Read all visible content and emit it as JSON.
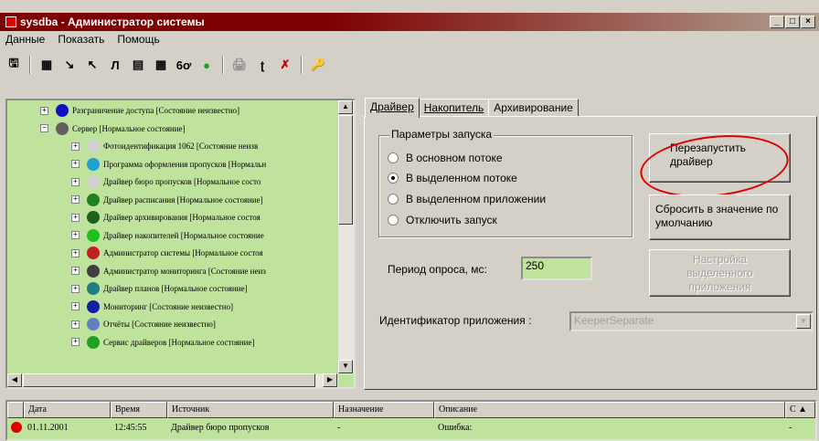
{
  "window": {
    "title": "sysdba - Администратор системы",
    "min_glyph": "_",
    "max_glyph": "□",
    "close_glyph": "×"
  },
  "menu": [
    "Данные",
    "Показать",
    "Помощь"
  ],
  "toolbar": [
    "🖫",
    "▦",
    "↘",
    "↖",
    "Л",
    "▤",
    "▦",
    "6ơ",
    "●",
    "🖨",
    "ʈ",
    "✗",
    "🔑"
  ],
  "tree": {
    "nodes": [
      {
        "label": "Разграничение доступа [Состояние неизвестно]",
        "icon_color": "#1010c0",
        "indent": 0
      },
      {
        "label": "Сервер [Нормальное состояние]",
        "icon_color": "#606060",
        "indent": 0,
        "expanded": true
      },
      {
        "label": "Фотоидентификация 1062 [Состояние неизв",
        "icon_color": "#d0d0d0",
        "indent": 1
      },
      {
        "label": "Программа оформления пропусков [Нормальн",
        "icon_color": "#20a0d0",
        "indent": 1
      },
      {
        "label": "Драйвер бюро пропусков [Нормальное состо",
        "icon_color": "#d0d0d0",
        "indent": 1
      },
      {
        "label": "Драйвер расписания [Нормальное состояние]",
        "icon_color": "#208020",
        "indent": 1
      },
      {
        "label": "Драйвер архивирования [Нормальное состоя",
        "icon_color": "#206020",
        "indent": 1
      },
      {
        "label": "Драйвер накопителей [Нормальное состояние",
        "icon_color": "#20c020",
        "indent": 1
      },
      {
        "label": "Администратор системы [Нормальное состоя",
        "icon_color": "#c02020",
        "indent": 1
      },
      {
        "label": "Администратор мониторинга [Состояние неиз",
        "icon_color": "#404040",
        "indent": 1
      },
      {
        "label": "Драйвер планов [Нормальное состояние]",
        "icon_color": "#208080",
        "indent": 1
      },
      {
        "label": "Мониторинг [Состояние неизвестно]",
        "icon_color": "#1020a0",
        "indent": 1
      },
      {
        "label": "Отчёты [Состояние неизвестно]",
        "icon_color": "#6080c0",
        "indent": 1
      },
      {
        "label": "Сервис драйверов [Нормальное состояние]",
        "icon_color": "#20a020",
        "indent": 1
      }
    ]
  },
  "tabs": [
    {
      "label": "Драйвер",
      "active": true
    },
    {
      "label": "Накопитель",
      "active": false
    },
    {
      "label": "Архивирование",
      "active": false
    }
  ],
  "launch": {
    "group_title": "Параметры запуска",
    "options": [
      {
        "label": "В основном потоке",
        "selected": false
      },
      {
        "label": "В выделенном потоке",
        "selected": true
      },
      {
        "label": "В выделенном приложении",
        "selected": false
      },
      {
        "label": "Отключить запуск",
        "selected": false
      }
    ]
  },
  "buttons": {
    "restart": "Перезапустить драйвер",
    "reset": "Сбросить в значение по умолчанию",
    "settings": "Настройка выделенного приложения"
  },
  "poll": {
    "label": "Период опроса, мс:",
    "value": "250"
  },
  "app_id": {
    "label": "Идентификатор приложения :",
    "value": "KeeperSeparate"
  },
  "log": {
    "columns": [
      "Дата",
      "Время",
      "Источник",
      "Назначение",
      "Описание",
      "С"
    ],
    "rows": [
      {
        "date": "01.11.2001",
        "time": "12:45:55",
        "source": "Драйвер бюро пропусков",
        "dest": "-",
        "desc": "Ошибка:",
        "extra": "-",
        "status_color": "#e00000"
      }
    ]
  },
  "accent": {
    "tree_bg": "#bfe29d",
    "highlight": "#e00000",
    "title_bg": "#7d0000"
  }
}
